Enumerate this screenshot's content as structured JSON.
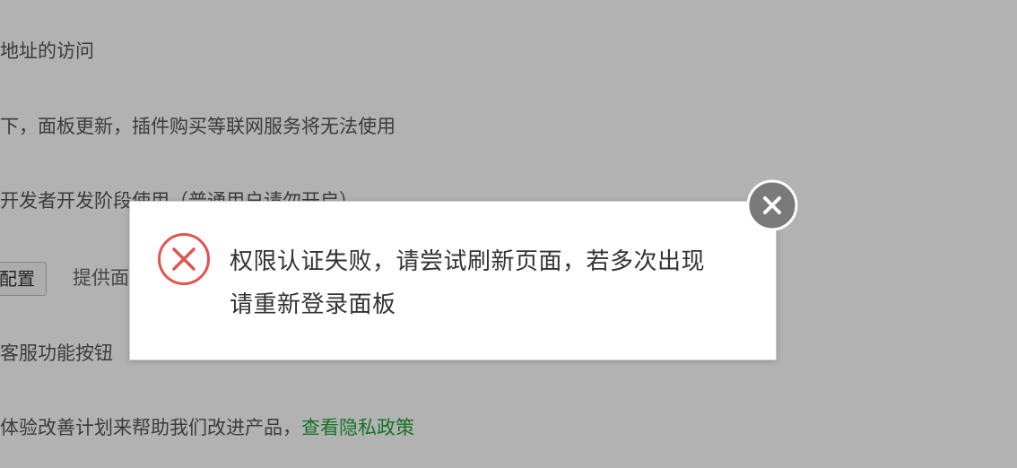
{
  "settings": {
    "line1": "地址的访问",
    "line2": "下，面板更新，插件购买等联网服务将无法使用",
    "line3": "开发者开发阶段使用（普通用户请勿开启）",
    "config_button_label": "配置",
    "config_description": "提供面",
    "line5": "客服功能按钮",
    "line6_text": "体验改善计划来帮助我们改进产品，",
    "privacy_link": "查看隐私政策"
  },
  "dialog": {
    "message_line1": "权限认证失败，请尝试刷新页面，若多次出现",
    "message_line2": "请重新登录面板",
    "icon": "error-x-icon",
    "close_icon": "close-icon"
  },
  "colors": {
    "accent_green": "#20a53a",
    "error_red": "#e0554f",
    "close_gray": "#7a7a7a"
  }
}
